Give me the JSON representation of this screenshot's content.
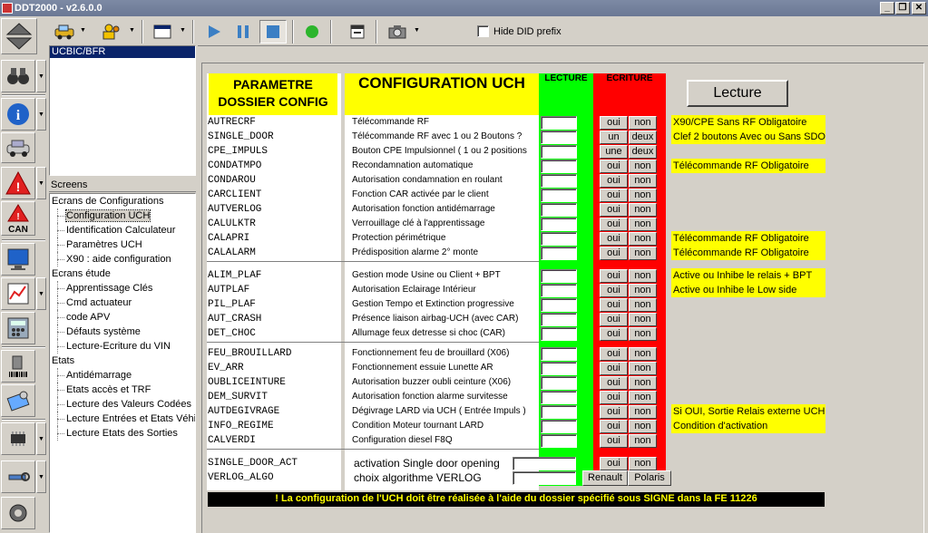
{
  "window": {
    "title": "DDT2000 - v2.6.0.0",
    "controls": [
      "_",
      "❐",
      "✕"
    ]
  },
  "toolbar": {
    "hide_did_label": "Hide DID prefix"
  },
  "ecu_list": {
    "selected": "UCBIC/BFR"
  },
  "tree": {
    "header": "Screens",
    "categories": [
      {
        "label": "Ecrans de Configurations",
        "items": [
          "Configuration UCH",
          "Identification Calculateur",
          "Paramètres UCH",
          "X90 : aide configuration"
        ]
      },
      {
        "label": "Ecrans étude",
        "items": [
          "Apprentissage Clés",
          "Cmd actuateur",
          "code APV",
          "Défauts système",
          "Lecture-Ecriture du VIN"
        ]
      },
      {
        "label": "Etats",
        "items": [
          "Antidémarrage",
          "Etats accès et TRF",
          "Lecture des Valeurs Codées",
          "Lecture Entrées et Etats Véhic",
          "Lecture Etats des Sorties"
        ]
      }
    ]
  },
  "screen": {
    "hdr_param": "PARAMETRE DOSSIER CONFIG",
    "hdr_config": "CONFIGURATION UCH",
    "hdr_lecture": "LECTURE",
    "hdr_ecriture": "ECRITURE",
    "lecture_button": "Lecture",
    "groups": [
      {
        "rows": [
          {
            "name": "AUTRECRF",
            "desc": "Télécommande RF",
            "b1": "oui",
            "b2": "non",
            "note": "X90/CPE Sans RF Obligatoire"
          },
          {
            "name": "SINGLE_DOOR",
            "desc": "Télécommande RF avec 1 ou 2 Boutons ?",
            "b1": "un",
            "b2": "deux",
            "note": "Clef 2 boutons Avec ou Sans SDO"
          },
          {
            "name": "CPE_IMPULS",
            "desc": "Bouton CPE Impulsionnel ( 1 ou 2 positions",
            "b1": "une",
            "b2": "deux",
            "note": ""
          },
          {
            "name": "CONDATMPO",
            "desc": "Recondamnation automatique",
            "b1": "oui",
            "b2": "non",
            "note": "Télécommande RF Obligatoire"
          },
          {
            "name": "CONDAROU",
            "desc": "Autorisation condamnation en roulant",
            "b1": "oui",
            "b2": "non",
            "note": ""
          },
          {
            "name": "CARCLIENT",
            "desc": "Fonction CAR activée par le client",
            "b1": "oui",
            "b2": "non",
            "note": ""
          },
          {
            "name": "AUTVERLOG",
            "desc": "Autorisation  fonction antidémarrage",
            "b1": "oui",
            "b2": "non",
            "note": ""
          },
          {
            "name": "CALULKTR",
            "desc": "Verrouillage clé à l'apprentissage",
            "b1": "oui",
            "b2": "non",
            "note": ""
          },
          {
            "name": "CALAPRI",
            "desc": "Protection périmétrique",
            "b1": "oui",
            "b2": "non",
            "note": "Télécommande RF Obligatoire"
          },
          {
            "name": "CALALARM",
            "desc": "Prédisposition alarme 2° monte",
            "b1": "oui",
            "b2": "non",
            "note": "Télécommande RF Obligatoire"
          }
        ]
      },
      {
        "rows": [
          {
            "name": "ALIM_PLAF",
            "desc": "Gestion mode Usine ou Client + BPT",
            "b1": "oui",
            "b2": "non",
            "note": "Active ou Inhibe le relais + BPT"
          },
          {
            "name": "AUTPLAF",
            "desc": "Autorisation Eclairage Intérieur",
            "b1": "oui",
            "b2": "non",
            "note": "Active ou Inhibe le Low side"
          },
          {
            "name": "PIL_PLAF",
            "desc": "Gestion Tempo et Extinction progressive",
            "b1": "oui",
            "b2": "non",
            "note": ""
          },
          {
            "name": "AUT_CRASH",
            "desc": "Présence liaison airbag-UCH (avec CAR)",
            "b1": "oui",
            "b2": "non",
            "note": ""
          },
          {
            "name": "DET_CHOC",
            "desc": "Allumage feux detresse si choc (CAR)",
            "b1": "oui",
            "b2": "non",
            "note": ""
          }
        ]
      },
      {
        "rows": [
          {
            "name": "FEU_BROUILLARD",
            "desc": "Fonctionnement feu de brouillard (X06)",
            "b1": "oui",
            "b2": "non",
            "note": ""
          },
          {
            "name": "EV_ARR",
            "desc": "Fonctionnement essuie Lunette AR",
            "b1": "oui",
            "b2": "non",
            "note": ""
          },
          {
            "name": "OUBLICEINTURE",
            "desc": "Autorisation buzzer oubli ceinture (X06)",
            "b1": "oui",
            "b2": "non",
            "note": ""
          },
          {
            "name": "DEM_SURVIT",
            "desc": "Autorisation fonction alarme survitesse",
            "b1": "oui",
            "b2": "non",
            "note": ""
          },
          {
            "name": "AUTDEGIVRAGE",
            "desc": "Dégivrage LARD via UCH ( Entrée Impuls )",
            "b1": "oui",
            "b2": "non",
            "note": "Si OUI, Sortie Relais externe UCH"
          },
          {
            "name": "INFO_REGIME",
            "desc": "Condition Moteur tournant LARD",
            "b1": "oui",
            "b2": "non",
            "note": "Condition d'activation"
          },
          {
            "name": "CALVERDI",
            "desc": "Configuration diesel F8Q",
            "b1": "oui",
            "b2": "non",
            "note": ""
          }
        ]
      }
    ],
    "extra_rows": [
      {
        "name": "SINGLE_DOOR_ACT",
        "desc": "activation Single door opening",
        "b1": "oui",
        "b2": "non"
      },
      {
        "name": "VERLOG_ALGO",
        "desc": "choix algorithme VERLOG",
        "b1": "Renault",
        "b2": "Polaris"
      }
    ],
    "warning": "! La configuration de l'UCH doit être réalisée à l'aide du dossier spécifié sous SIGNE dans la FE 11226"
  }
}
